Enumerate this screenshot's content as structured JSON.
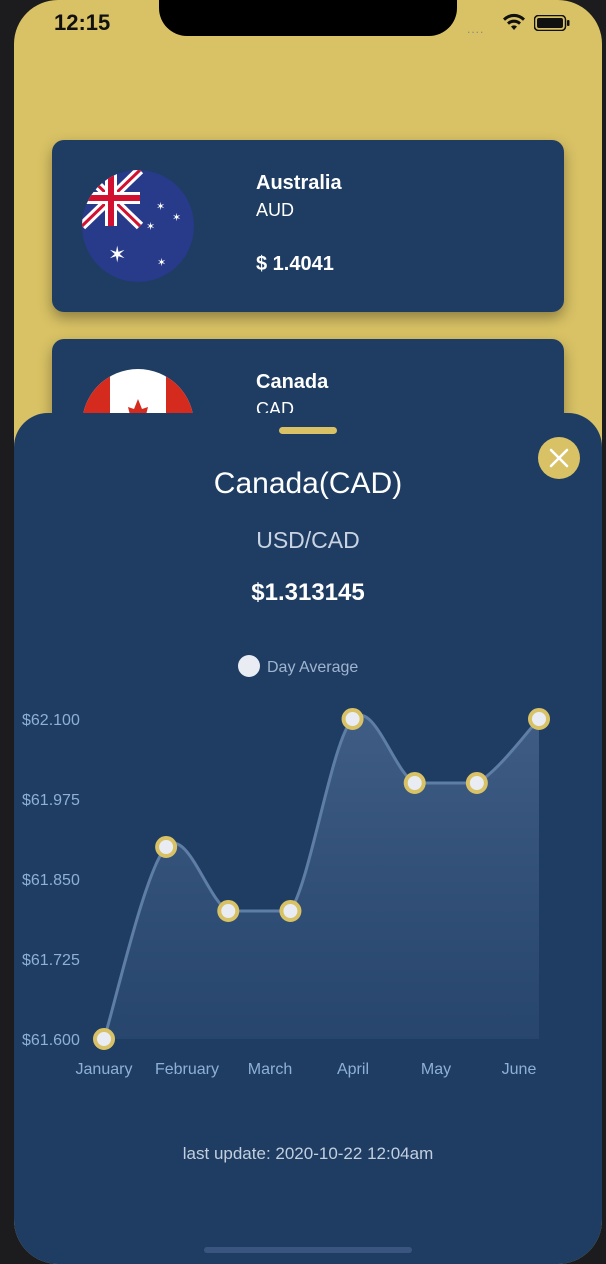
{
  "status": {
    "time": "12:15",
    "dots": "...."
  },
  "cards": [
    {
      "country": "Australia",
      "code": "AUD",
      "rate": "$ 1.4041",
      "flag": "australia-flag"
    },
    {
      "country": "Canada",
      "code": "CAD",
      "rate": "",
      "flag": "canada-flag"
    }
  ],
  "sheet": {
    "title": "Canada(CAD)",
    "pair": "USD/CAD",
    "rate": "$1.313145",
    "legend_label": "Day Average",
    "last_update": "last update: 2020-10-22 12:04am"
  },
  "colors": {
    "accent": "#d9c265",
    "panel": "#1f3d63",
    "point": "#e9edf3"
  },
  "chart_data": {
    "type": "line",
    "categories": [
      "January",
      "February",
      "March",
      "April",
      "May",
      "June"
    ],
    "series": [
      {
        "name": "Day Average",
        "values": [
          61.6,
          61.9,
          61.8,
          62.1,
          62.0,
          62.0,
          62.1
        ]
      }
    ],
    "x_points": [
      "January",
      "February",
      "March",
      "March/April",
      "April",
      "May",
      "May/June",
      "June"
    ],
    "points": [
      61.6,
      61.9,
      61.8,
      61.8,
      62.1,
      62.0,
      62.0,
      62.1
    ],
    "ylim": [
      61.6,
      62.1
    ],
    "yticks": [
      "$62.100",
      "$61.975",
      "$61.850",
      "$61.725",
      "$61.600"
    ],
    "area_fill": true,
    "smooth": true
  }
}
